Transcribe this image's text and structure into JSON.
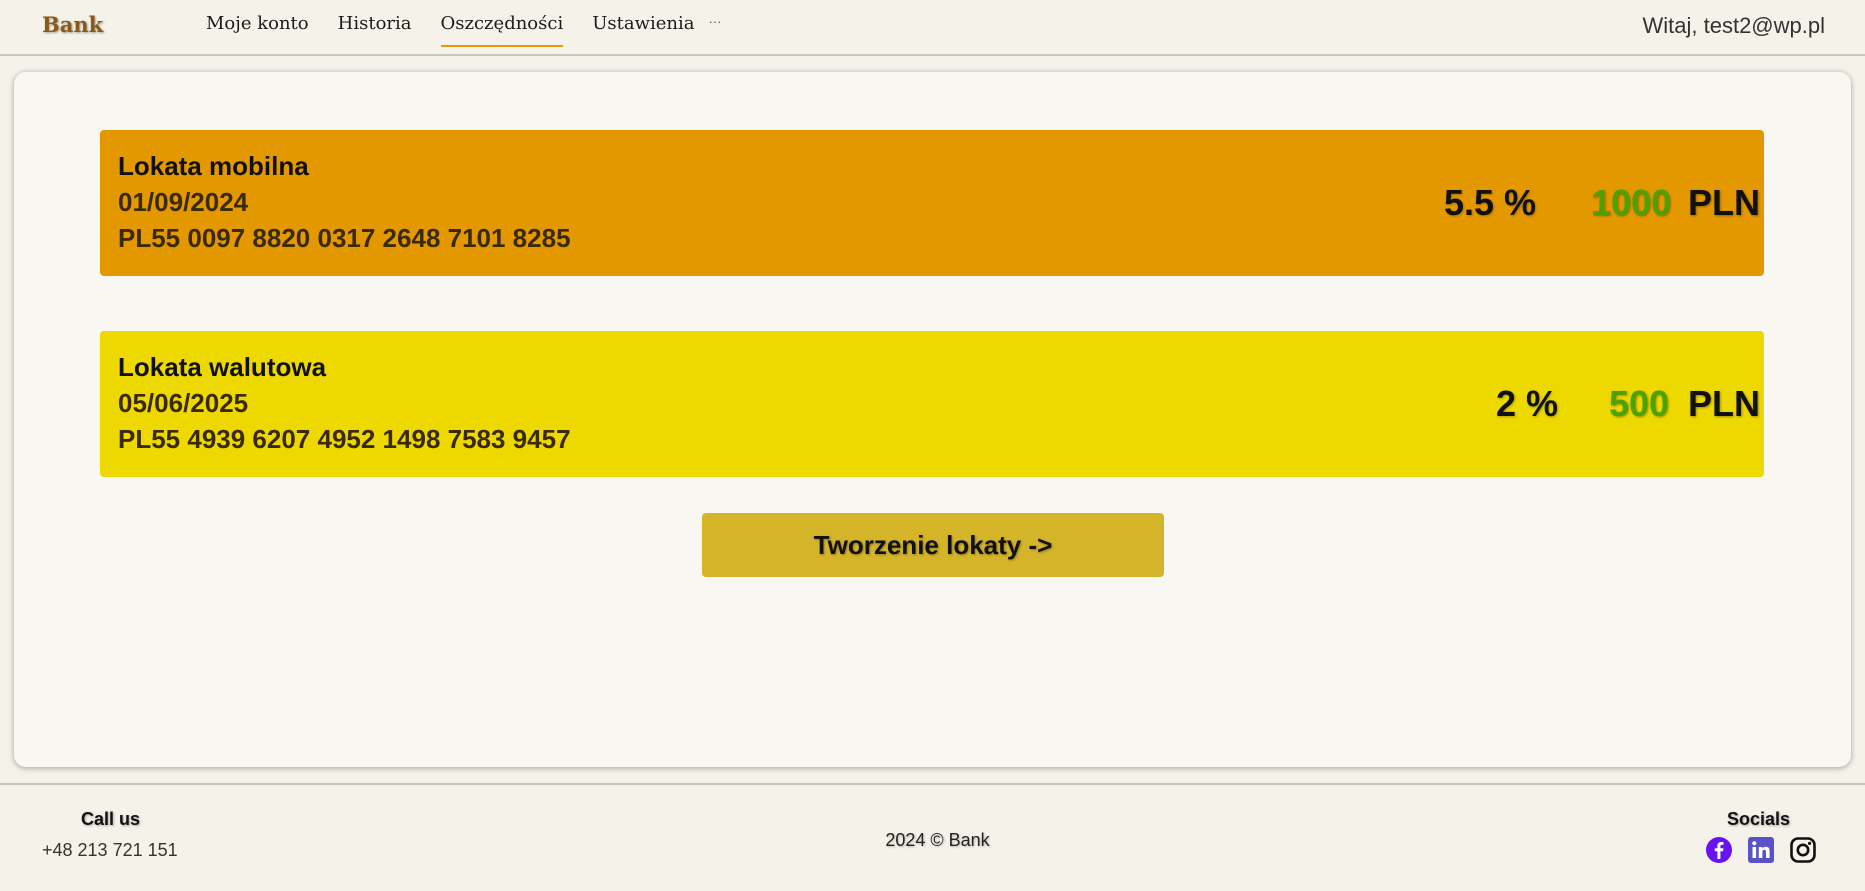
{
  "header": {
    "brand": "Bank",
    "nav": [
      "Moje konto",
      "Historia",
      "Oszczędności",
      "Ustawienia"
    ],
    "active_nav": "Oszczędności",
    "more": "···",
    "greeting": "Witaj, test2@wp.pl"
  },
  "deposits": [
    {
      "name": "Lokata mobilna",
      "date": "01/09/2024",
      "account": "PL55 0097 8820 0317 2648 7101 8285",
      "rate": "5.5 %",
      "amount": "1000",
      "currency": "PLN",
      "color": "#e49800"
    },
    {
      "name": "Lokata walutowa",
      "date": "05/06/2025",
      "account": "PL55 4939 6207 4952 1498 7583 9457",
      "rate": "2 %",
      "amount": "500",
      "currency": "PLN",
      "color": "#edd800"
    }
  ],
  "create_button": "Tworzenie lokaty ->",
  "footer": {
    "call_title": "Call us",
    "phone": "+48 213 721 151",
    "copyright": "2024 © Bank",
    "socials_title": "Socials",
    "socials": [
      "facebook-icon",
      "linkedin-icon",
      "instagram-icon"
    ]
  },
  "colors": {
    "accent": "#e39a10",
    "amount_green": "#4aa300",
    "button": "#d4b52a",
    "facebook": "#6a12f0",
    "linkedin": "#5a52c8"
  }
}
